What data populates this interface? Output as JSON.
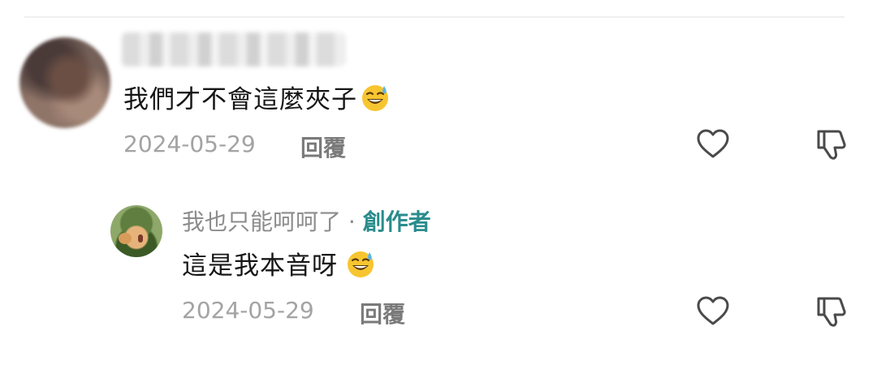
{
  "comment": {
    "username": "",
    "text": "我們才不會這麼夾子",
    "emoji": "sweat-smile-emoji",
    "date": "2024-05-29",
    "reply_label": "回覆"
  },
  "reply": {
    "username": "我也只能呵呵了",
    "separator": " · ",
    "badge": "創作者",
    "text": "這是我本音呀",
    "emoji": "sweat-smile-emoji",
    "date": "2024-05-29",
    "reply_label": "回覆"
  },
  "colors": {
    "text": "#161616",
    "meta": "#a3a3a3",
    "creator": "#2a8c8c",
    "icon": "#4a4a4a"
  }
}
